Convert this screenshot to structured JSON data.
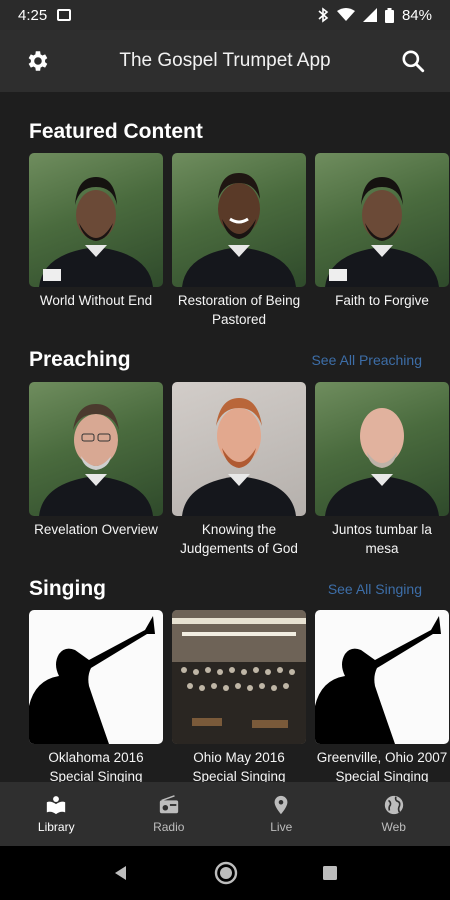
{
  "status": {
    "time": "4:25",
    "battery": "84%"
  },
  "app": {
    "title": "The Gospel Trumpet App"
  },
  "featured": {
    "title": "Featured Content",
    "items": [
      {
        "label": "World Without End"
      },
      {
        "label": "Restoration of Being Pastored"
      },
      {
        "label": "Faith to Forgive"
      }
    ]
  },
  "preaching": {
    "title": "Preaching",
    "see_all": "See All Preaching",
    "items": [
      {
        "label": "Revelation Overview"
      },
      {
        "label": "Knowing the Judgements of God"
      },
      {
        "label": "Juntos tumbar la mesa"
      }
    ]
  },
  "singing": {
    "title": "Singing",
    "see_all": "See All Singing",
    "items": [
      {
        "label": "Oklahoma 2016 Special Singing"
      },
      {
        "label": "Ohio May 2016 Special Singing"
      },
      {
        "label": "Greenville, Ohio 2007 Special Singing"
      }
    ]
  },
  "nav": {
    "items": [
      {
        "label": "Library",
        "icon": "library-icon",
        "active": true
      },
      {
        "label": "Radio",
        "icon": "radio-icon"
      },
      {
        "label": "Live",
        "icon": "location-pin-icon"
      },
      {
        "label": "Web",
        "icon": "globe-icon"
      }
    ]
  },
  "colors": {
    "accent_link": "#3d6ea8",
    "app_bar": "#2e2e2e",
    "content_bg": "#1e1e1e"
  }
}
